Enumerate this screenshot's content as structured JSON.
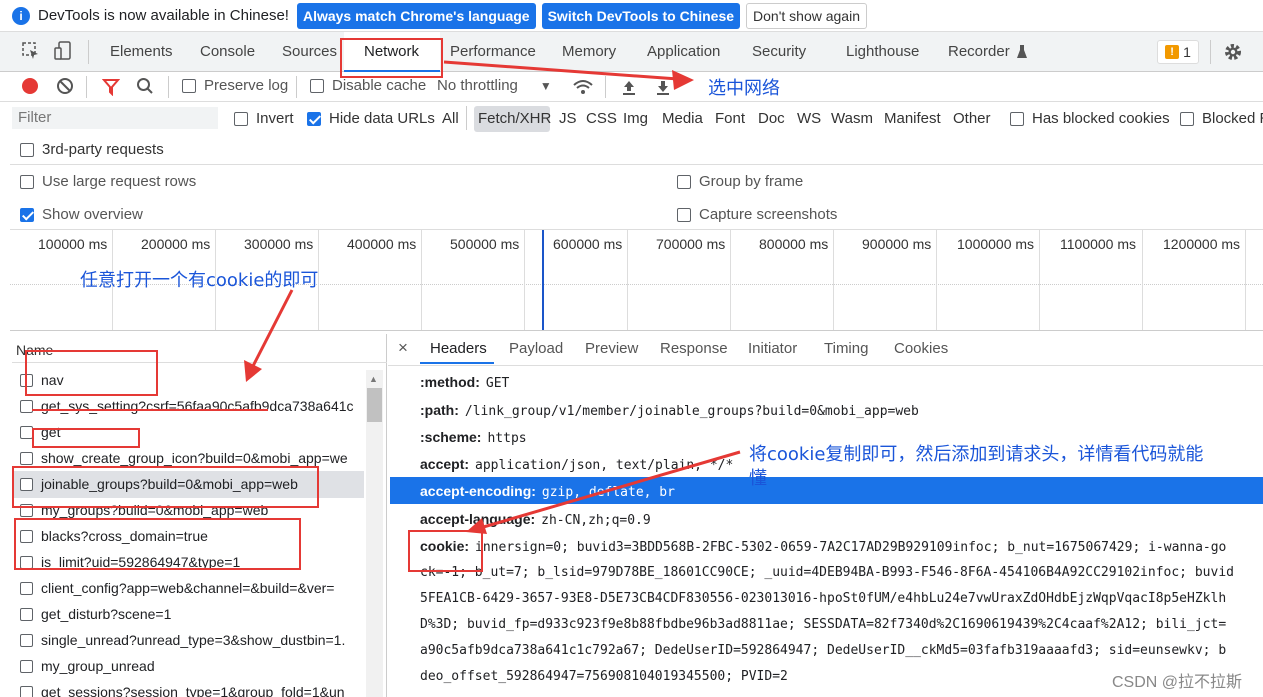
{
  "infobar": {
    "message": "DevTools is now available in Chinese!",
    "btn_match": "Always match Chrome's language",
    "btn_switch": "Switch DevTools to Chinese",
    "btn_dismiss": "Don't show again"
  },
  "tabs": [
    "Elements",
    "Console",
    "Sources",
    "Network",
    "Performance",
    "Memory",
    "Application",
    "Security",
    "Lighthouse",
    "Recorder"
  ],
  "issues_count": "1",
  "toolbar": {
    "preserve_log": "Preserve log",
    "disable_cache": "Disable cache",
    "throttling": "No throttling"
  },
  "filter": {
    "placeholder": "Filter",
    "invert": "Invert",
    "hide_data_urls": "Hide data URLs",
    "types": [
      "All",
      "Fetch/XHR",
      "JS",
      "CSS",
      "Img",
      "Media",
      "Font",
      "Doc",
      "WS",
      "Wasm",
      "Manifest",
      "Other"
    ],
    "blocked_cookies": "Has blocked cookies",
    "blocked": "Blocked Re",
    "third_party": "3rd-party requests"
  },
  "options": {
    "large_rows": "Use large request rows",
    "show_overview": "Show overview",
    "group_by_frame": "Group by frame",
    "capture_screenshots": "Capture screenshots"
  },
  "timeline_ticks": [
    "100000 ms",
    "200000 ms",
    "300000 ms",
    "400000 ms",
    "500000 ms",
    "600000 ms",
    "700000 ms",
    "800000 ms",
    "900000 ms",
    "1000000 ms",
    "1100000 ms",
    "1200000 ms"
  ],
  "annotations": {
    "select_network": "选中网络",
    "open_cookie": "任意打开一个有cookie的即可",
    "copy_cookie": "将cookie复制即可，然后添加到请求头，详情看代码就能",
    "copy_cookie_2": "懂"
  },
  "name_header": "Name",
  "requests": [
    "nav",
    "get_sys_setting?csrf=56faa90c5afb9dca738a641c",
    "get",
    "show_create_group_icon?build=0&mobi_app=we",
    "joinable_groups?build=0&mobi_app=web",
    "my_groups?build=0&mobi_app=web",
    "blacks?cross_domain=true",
    "is_limit?uid=592864947&type=1",
    "client_config?app=web&channel=&build=&ver=",
    "get_disturb?scene=1",
    "single_unread?unread_type=3&show_dustbin=1.",
    "my_group_unread",
    "get_sessions?session_type=1&group_fold=1&un"
  ],
  "detail_tabs": [
    "Headers",
    "Payload",
    "Preview",
    "Response",
    "Initiator",
    "Timing",
    "Cookies"
  ],
  "headers": [
    {
      "k": ":method:",
      "v": "GET"
    },
    {
      "k": ":path:",
      "v": "/link_group/v1/member/joinable_groups?build=0&mobi_app=web"
    },
    {
      "k": ":scheme:",
      "v": "https"
    },
    {
      "k": "accept:",
      "v": "application/json, text/plain, */*"
    },
    {
      "k": "accept-encoding:",
      "v": "gzip, deflate, br"
    },
    {
      "k": "accept-language:",
      "v": "zh-CN,zh;q=0.9"
    },
    {
      "k": "cookie:",
      "v": "innersign=0; buvid3=3BDD568B-2FBC-5302-0659-7A2C17AD29B929109infoc; b_nut=1675067429; i-wanna-go"
    }
  ],
  "cookie_cont": [
    "ck=-1; b_ut=7; b_lsid=979D78BE_18601CC90CE; _uuid=4DEB94BA-B993-F546-8F6A-454106B4A92CC29102infoc; buvid",
    "5FEA1CB-6429-3657-93E8-D5E73CB4CDF830556-023013016-hpoSt0fUM/e4hbLu24e7vwUraxZdOHdbEjzWqpVqacI8p5eHZklh",
    "D%3D; buvid_fp=d933c923f9e8b88fbdbe96b3ad8811ae; SESSDATA=82f7340d%2C1690619439%2C4caaf%2A12; bili_jct=",
    "a90c5afb9dca738a641c1c792a67; DedeUserID=592864947; DedeUserID__ckMd5=03fafb319aaaafd3; sid=eunsewkv; b",
    "deo_offset_592864947=756908104019345500; PVID=2"
  ],
  "watermark": "CSDN @拉不拉斯"
}
